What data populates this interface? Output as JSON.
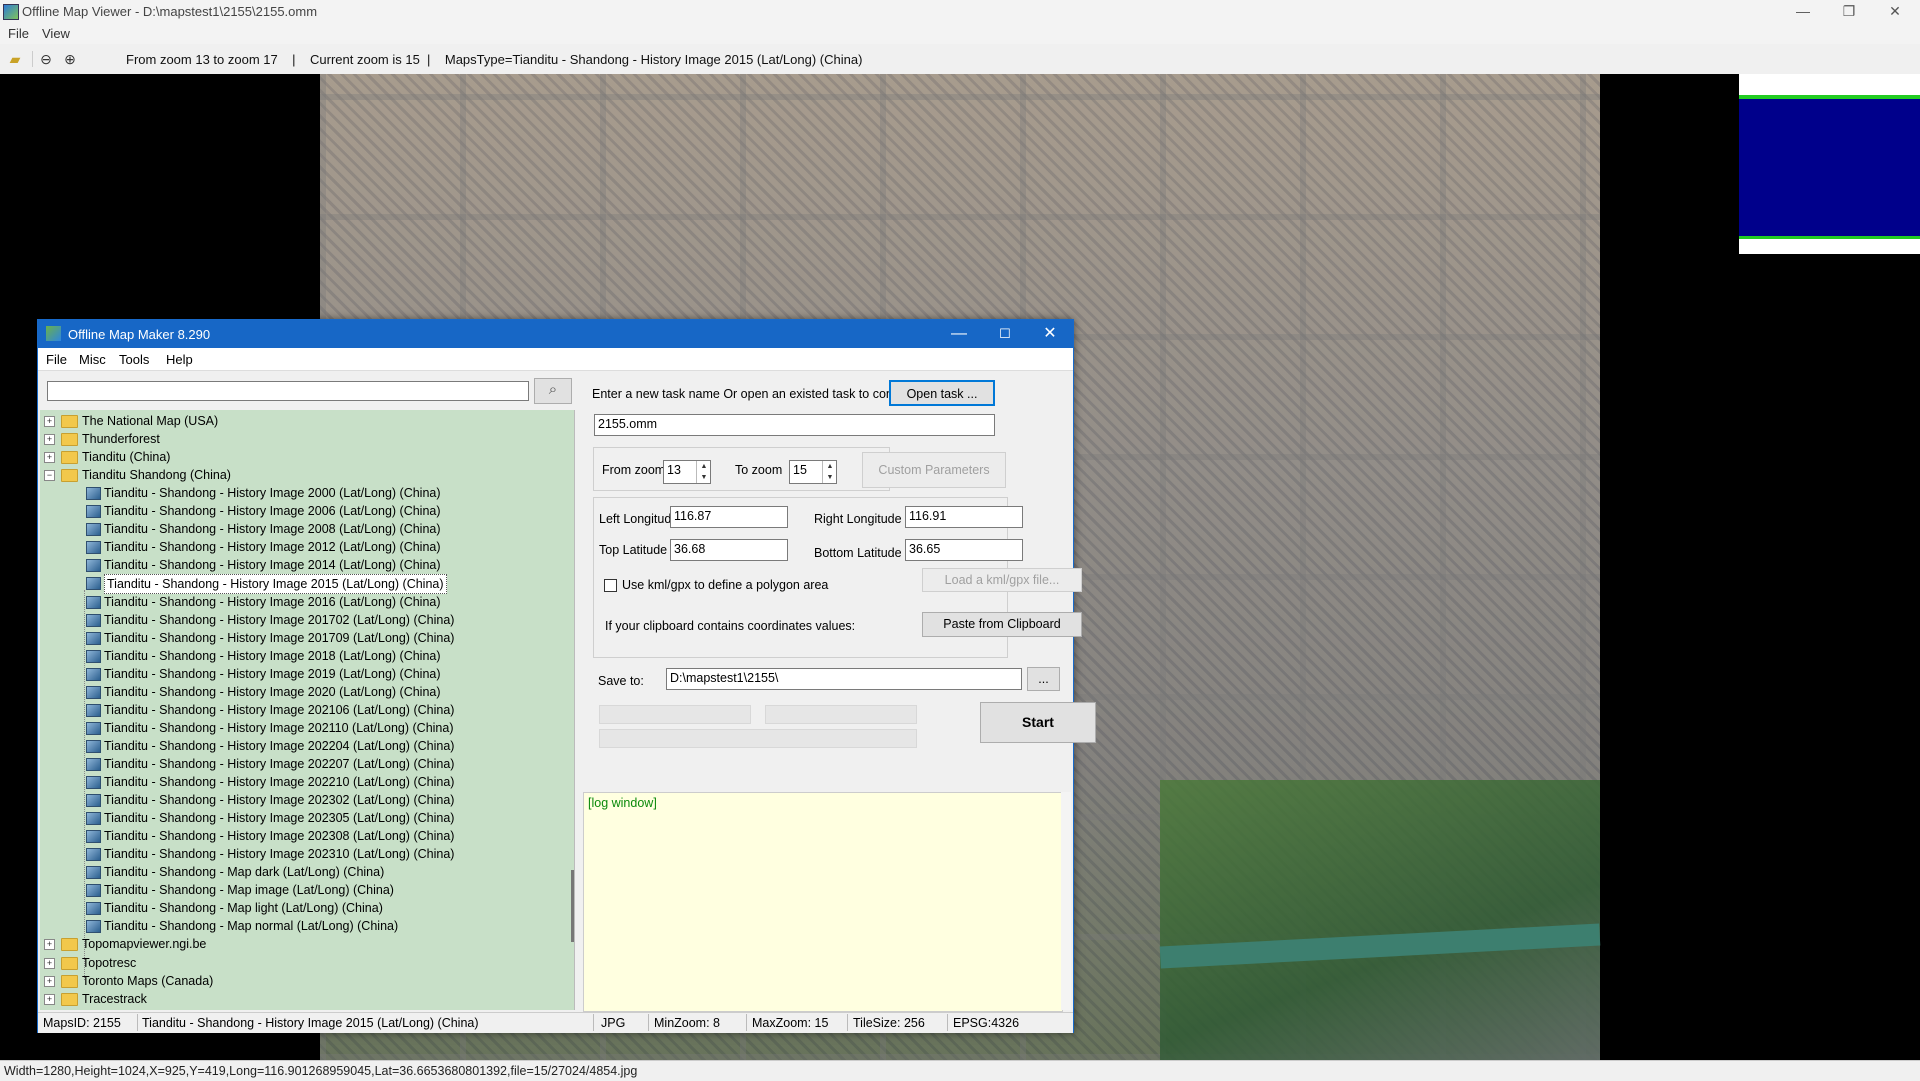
{
  "viewer": {
    "title": "Offline Map Viewer - D:\\mapstest1\\2155\\2155.omm",
    "menu": [
      "File",
      "View"
    ],
    "toolbar_info": "From zoom 13 to zoom 17    |    Current zoom is 15  |    MapsType=Tianditu - Shandong - History Image 2015 (Lat/Long) (China)",
    "status": "Width=1280,Height=1024,X=925,Y=419,Long=116.901268959045,Lat=36.6653680801392,file=15/27024/4854.jpg",
    "icons": [
      "open-folder-icon",
      "zoom-out-icon",
      "zoom-in-icon"
    ]
  },
  "dialog": {
    "title": "Offline Map Maker 8.290",
    "menu": [
      "File",
      "Misc",
      "Tools",
      "Help"
    ],
    "search_placeholder": "",
    "tree": [
      {
        "label": "The National Map (USA)",
        "level": 0,
        "type": "folder",
        "expanded": false
      },
      {
        "label": "Thunderforest",
        "level": 0,
        "type": "folder",
        "expanded": false
      },
      {
        "label": "Tianditu (China)",
        "level": 0,
        "type": "folder",
        "expanded": false
      },
      {
        "label": "Tianditu Shandong (China)",
        "level": 0,
        "type": "folder",
        "expanded": true
      },
      {
        "label": "Tianditu - Shandong - History Image 2000 (Lat/Long) (China)",
        "level": 1,
        "type": "map"
      },
      {
        "label": "Tianditu - Shandong - History Image 2006 (Lat/Long) (China)",
        "level": 1,
        "type": "map"
      },
      {
        "label": "Tianditu - Shandong - History Image 2008 (Lat/Long) (China)",
        "level": 1,
        "type": "map"
      },
      {
        "label": "Tianditu - Shandong - History Image 2012 (Lat/Long) (China)",
        "level": 1,
        "type": "map"
      },
      {
        "label": "Tianditu - Shandong - History Image 2014 (Lat/Long) (China)",
        "level": 1,
        "type": "map"
      },
      {
        "label": "Tianditu - Shandong - History Image 2015 (Lat/Long) (China)",
        "level": 1,
        "type": "map",
        "selected": true
      },
      {
        "label": "Tianditu - Shandong - History Image 2016 (Lat/Long) (China)",
        "level": 1,
        "type": "map"
      },
      {
        "label": "Tianditu - Shandong - History Image 201702 (Lat/Long) (China)",
        "level": 1,
        "type": "map"
      },
      {
        "label": "Tianditu - Shandong - History Image 201709 (Lat/Long) (China)",
        "level": 1,
        "type": "map"
      },
      {
        "label": "Tianditu - Shandong - History Image 2018 (Lat/Long) (China)",
        "level": 1,
        "type": "map"
      },
      {
        "label": "Tianditu - Shandong - History Image 2019 (Lat/Long) (China)",
        "level": 1,
        "type": "map"
      },
      {
        "label": "Tianditu - Shandong - History Image 2020 (Lat/Long) (China)",
        "level": 1,
        "type": "map"
      },
      {
        "label": "Tianditu - Shandong - History Image 202106 (Lat/Long) (China)",
        "level": 1,
        "type": "map"
      },
      {
        "label": "Tianditu - Shandong - History Image 202110 (Lat/Long) (China)",
        "level": 1,
        "type": "map"
      },
      {
        "label": "Tianditu - Shandong - History Image 202204 (Lat/Long) (China)",
        "level": 1,
        "type": "map"
      },
      {
        "label": "Tianditu - Shandong - History Image 202207 (Lat/Long) (China)",
        "level": 1,
        "type": "map"
      },
      {
        "label": "Tianditu - Shandong - History Image 202210 (Lat/Long) (China)",
        "level": 1,
        "type": "map"
      },
      {
        "label": "Tianditu - Shandong - History Image 202302 (Lat/Long) (China)",
        "level": 1,
        "type": "map"
      },
      {
        "label": "Tianditu - Shandong - History Image 202305 (Lat/Long) (China)",
        "level": 1,
        "type": "map"
      },
      {
        "label": "Tianditu - Shandong - History Image 202308 (Lat/Long) (China)",
        "level": 1,
        "type": "map"
      },
      {
        "label": "Tianditu - Shandong - History Image 202310 (Lat/Long) (China)",
        "level": 1,
        "type": "map"
      },
      {
        "label": "Tianditu - Shandong - Map dark (Lat/Long) (China)",
        "level": 1,
        "type": "map"
      },
      {
        "label": "Tianditu - Shandong - Map image (Lat/Long) (China)",
        "level": 1,
        "type": "map"
      },
      {
        "label": "Tianditu - Shandong - Map light (Lat/Long) (China)",
        "level": 1,
        "type": "map"
      },
      {
        "label": "Tianditu - Shandong - Map normal (Lat/Long) (China)",
        "level": 1,
        "type": "map"
      },
      {
        "label": "Topomapviewer.ngi.be",
        "level": 0,
        "type": "folder",
        "expanded": false
      },
      {
        "label": "Topotresc",
        "level": 0,
        "type": "folder",
        "expanded": false
      },
      {
        "label": "Toronto Maps (Canada)",
        "level": 0,
        "type": "folder",
        "expanded": false
      },
      {
        "label": "Tracestrack",
        "level": 0,
        "type": "folder",
        "expanded": false
      }
    ],
    "task_prompt": "Enter a new task name Or open an existed task to continue:",
    "open_task_label": "Open task ...",
    "task_name": "2155.omm",
    "from_zoom_label": "From zoom",
    "from_zoom": "13",
    "to_zoom_label": "To zoom",
    "to_zoom": "15",
    "custom_params_label": "Custom Parameters",
    "left_lon_label": "Left Longitude",
    "left_lon": "116.87",
    "right_lon_label": "Right Longitude",
    "right_lon": "116.91",
    "top_lat_label": "Top Latitude",
    "top_lat": "36.68",
    "bottom_lat_label": "Bottom Latitude",
    "bottom_lat": "36.65",
    "kml_checkbox_label": "Use kml/gpx to define a polygon area",
    "load_kml_label": "Load a kml/gpx file...",
    "clipboard_prompt": "If your clipboard contains coordinates values:",
    "paste_label": "Paste from Clipboard",
    "save_to_label": "Save to:",
    "save_path": "D:\\mapstest1\\2155\\",
    "browse_label": "...",
    "start_label": "Start",
    "log_text": "[log window]",
    "status": {
      "maps_id": "MapsID: 2155",
      "map_name": "Tianditu - Shandong - History Image 2015 (Lat/Long) (China)",
      "format": "JPG",
      "min_zoom": "MinZoom: 8",
      "max_zoom": "MaxZoom: 15",
      "tile_size": "TileSize: 256",
      "epsg": "EPSG:4326"
    }
  },
  "colors": {
    "dialog_title": "#1767c6",
    "tree_bg": "#c8e0c8",
    "log_bg": "#ffffe0",
    "log_text": "#0a8a0a",
    "minimap_blue": "#00008b",
    "minimap_green": "#22cc22"
  }
}
